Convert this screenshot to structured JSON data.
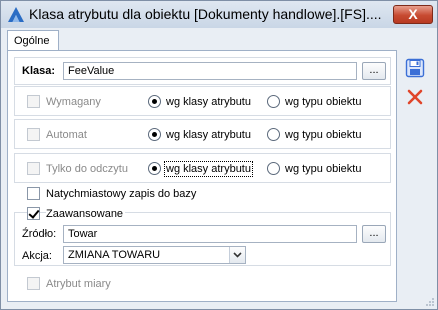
{
  "window": {
    "title": "Klasa atrybutu dla obiektu [Dokumenty handlowe].[FS]....",
    "close_label": "X"
  },
  "tabs": [
    {
      "label": "Ogólne",
      "active": true
    }
  ],
  "klasa": {
    "label": "Klasa:",
    "value": "FeeValue",
    "button_label": "..."
  },
  "wymagany": {
    "checkbox_label": "Wymagany",
    "radio_class_label": "wg klasy atrybutu",
    "radio_type_label": "wg typu obiektu",
    "selected": "class"
  },
  "automat": {
    "checkbox_label": "Automat",
    "radio_class_label": "wg klasy atrybutu",
    "radio_type_label": "wg typu obiektu",
    "selected": "class"
  },
  "readonly": {
    "checkbox_label": "Tylko do odczytu",
    "radio_class_label": "wg klasy atrybutu",
    "radio_type_label": "wg typu obiektu",
    "selected": "class"
  },
  "natychmiastowy": {
    "label": "Natychmiastowy zapis do bazy",
    "checked": false
  },
  "zaawansowane": {
    "label": "Zaawansowane",
    "checked": true,
    "source_label": "Źródło:",
    "source_value": "Towar",
    "source_button": "...",
    "action_label": "Akcja:",
    "action_value": "ZMIANA TOWARU"
  },
  "atrybut_miary": {
    "label": "Atrybut miary",
    "checked": false
  },
  "side_buttons": {
    "save": "save-icon",
    "cancel": "cancel-icon"
  },
  "colors": {
    "save_icon": "#3b6fd6",
    "cancel_icon": "#e0452a",
    "app_icon": "#2a6cc4"
  }
}
